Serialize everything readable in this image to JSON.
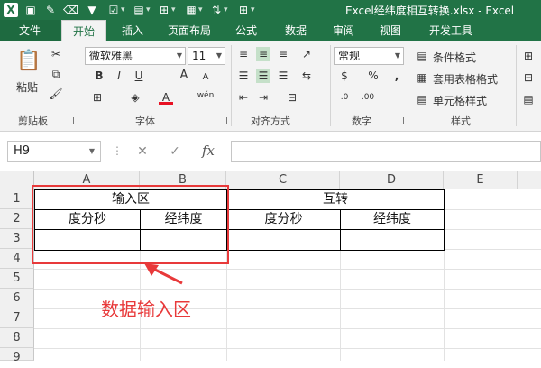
{
  "window": {
    "title": "Excel经纬度相互转换.xlsx - Excel"
  },
  "quick_access": [
    "excel-logo",
    "save-icon",
    "paint-brush-icon",
    "eraser-icon",
    "filter-icon",
    "check-box-icon",
    "document-icon",
    "grid-icon",
    "table-icon",
    "sort-icon",
    "grid-icon"
  ],
  "tabs": [
    {
      "id": "file",
      "label": "文件"
    },
    {
      "id": "home",
      "label": "开始"
    },
    {
      "id": "insert",
      "label": "插入"
    },
    {
      "id": "layout",
      "label": "页面布局"
    },
    {
      "id": "formulas",
      "label": "公式"
    },
    {
      "id": "data",
      "label": "数据"
    },
    {
      "id": "review",
      "label": "审阅"
    },
    {
      "id": "view",
      "label": "视图"
    },
    {
      "id": "dev",
      "label": "开发工具"
    }
  ],
  "ribbon": {
    "clipboard": {
      "label": "剪贴板",
      "paste": "粘贴"
    },
    "font": {
      "label": "字体",
      "name": "微软雅黑",
      "size": "11",
      "bold": "B",
      "italic": "I",
      "underline": "U",
      "grow": "A",
      "shrink": "A",
      "wen": "wén",
      "color_letter": "A"
    },
    "alignment": {
      "label": "对齐方式"
    },
    "number": {
      "label": "数字",
      "format": "常规",
      "percent": "%",
      "comma": ","
    },
    "styles": {
      "label": "样式",
      "conditional": "条件格式",
      "table_format": "套用表格格式",
      "cell_styles": "单元格样式"
    }
  },
  "formula_bar": {
    "name_box": "H9",
    "cancel": "✕",
    "enter": "✓",
    "fx": "fx",
    "formula": ""
  },
  "sheet": {
    "columns": [
      "A",
      "B",
      "C",
      "D",
      "E"
    ],
    "rows": [
      "1",
      "2",
      "3",
      "4",
      "5",
      "6",
      "7",
      "8",
      "9"
    ],
    "cells": {
      "A1": "输入区",
      "C1": "互转",
      "A2": "度分秒",
      "B2": "经纬度",
      "C2": "度分秒",
      "D2": "经纬度"
    }
  },
  "annotation": {
    "text": "数据输入区",
    "color": "#e8393a"
  },
  "colors": {
    "accent": "#217346",
    "annotation": "#e8393a"
  }
}
